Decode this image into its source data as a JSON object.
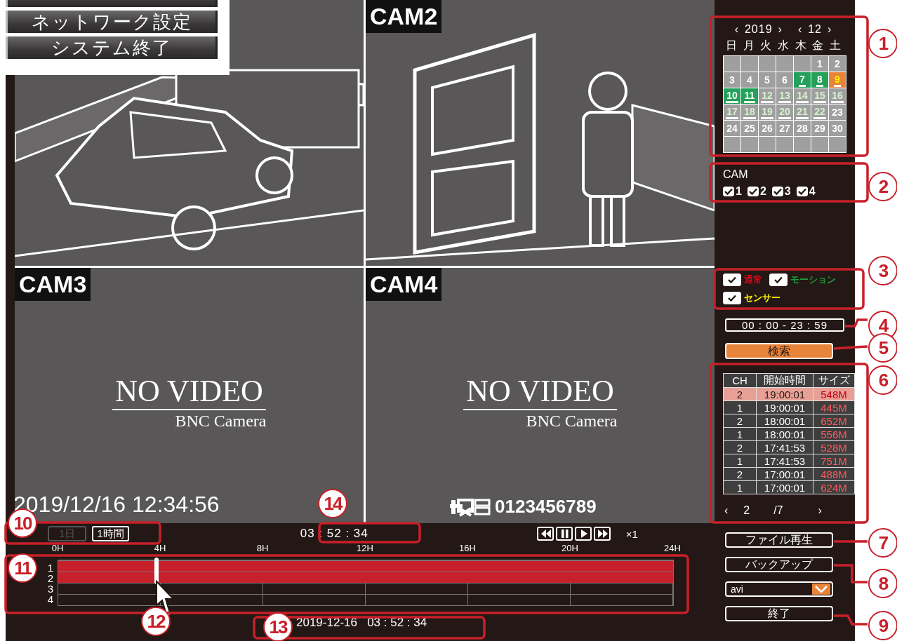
{
  "menu": {
    "items": [
      {
        "label": "ネットワーク設定"
      },
      {
        "label": "システム終了"
      }
    ]
  },
  "panes": [
    {
      "kind": "picture"
    },
    {
      "kind": "picture",
      "label": "CAM2"
    },
    {
      "kind": "no_video",
      "label": "CAM3",
      "message": "NO VIDEO",
      "source": "BNC Camera",
      "overlay": "2019/12/16  12:34:56"
    },
    {
      "kind": "no_video",
      "label": "CAM4",
      "message": "NO VIDEO",
      "source": "BNC Camera",
      "phone": "0123456789"
    }
  ],
  "calendar": {
    "prev_year": "‹",
    "year": "2019",
    "next_year": "›",
    "prev_month": "‹",
    "month": "12",
    "next_month": "›",
    "weekdays": [
      "日",
      "月",
      "火",
      "水",
      "木",
      "金",
      "土"
    ],
    "days": [
      {
        "kind": "empty"
      },
      {
        "kind": "empty"
      },
      {
        "kind": "empty"
      },
      {
        "kind": "empty"
      },
      {
        "kind": "empty"
      },
      {
        "label": "1",
        "kind": "plain"
      },
      {
        "label": "2",
        "kind": "plain"
      },
      {
        "label": "3",
        "kind": "plain"
      },
      {
        "label": "4",
        "kind": "plain"
      },
      {
        "label": "5",
        "kind": "plain"
      },
      {
        "label": "6",
        "kind": "plain"
      },
      {
        "label": "7",
        "kind": "marked"
      },
      {
        "label": "8",
        "kind": "marked"
      },
      {
        "label": "9",
        "kind": "selected"
      },
      {
        "label": "10",
        "kind": "marked"
      },
      {
        "label": "11",
        "kind": "marked"
      },
      {
        "label": "12",
        "kind": "recorded"
      },
      {
        "label": "13",
        "kind": "recorded"
      },
      {
        "label": "14",
        "kind": "recorded"
      },
      {
        "label": "15",
        "kind": "recorded"
      },
      {
        "label": "16",
        "kind": "recorded"
      },
      {
        "label": "17",
        "kind": "recorded"
      },
      {
        "label": "18",
        "kind": "recorded"
      },
      {
        "label": "19",
        "kind": "recorded"
      },
      {
        "label": "20",
        "kind": "recorded"
      },
      {
        "label": "21",
        "kind": "recorded"
      },
      {
        "label": "22",
        "kind": "recorded"
      },
      {
        "label": "23",
        "kind": "plain"
      },
      {
        "label": "24",
        "kind": "plain"
      },
      {
        "label": "25",
        "kind": "plain"
      },
      {
        "label": "26",
        "kind": "plain"
      },
      {
        "label": "27",
        "kind": "plain"
      },
      {
        "label": "28",
        "kind": "plain"
      },
      {
        "label": "29",
        "kind": "plain"
      },
      {
        "label": "30",
        "kind": "plain"
      },
      {
        "kind": "empty"
      },
      {
        "kind": "empty"
      },
      {
        "kind": "empty"
      },
      {
        "kind": "empty"
      },
      {
        "kind": "empty"
      },
      {
        "kind": "empty"
      },
      {
        "kind": "empty"
      }
    ]
  },
  "cam_filter": {
    "title": "CAM",
    "cams": [
      {
        "label": "1",
        "checked": true
      },
      {
        "label": "2",
        "checked": true
      },
      {
        "label": "3",
        "checked": true
      },
      {
        "label": "4",
        "checked": true
      }
    ]
  },
  "record_types": [
    {
      "label": "通常",
      "checked": true,
      "color": "#e60012"
    },
    {
      "label": "モーション",
      "checked": true,
      "color": "#1e9a3a"
    },
    {
      "label": "センサー",
      "checked": true,
      "color": "#fff100"
    }
  ],
  "time_range": "00 : 00 - 23 : 59",
  "search_button": "検索",
  "file_table": {
    "columns": [
      "CH",
      "開始時間",
      "サイズ"
    ],
    "rows": [
      {
        "ch": "2",
        "start": "19:00:01",
        "size": "548M",
        "selected": true
      },
      {
        "ch": "1",
        "start": "19:00:01",
        "size": "445M",
        "selected": false
      },
      {
        "ch": "2",
        "start": "18:00:01",
        "size": "652M",
        "selected": false
      },
      {
        "ch": "1",
        "start": "18:00:01",
        "size": "556M",
        "selected": false
      },
      {
        "ch": "2",
        "start": "17:41:53",
        "size": "528M",
        "selected": false
      },
      {
        "ch": "1",
        "start": "17:41:53",
        "size": "751M",
        "selected": false
      },
      {
        "ch": "2",
        "start": "17:00:01",
        "size": "488M",
        "selected": false
      },
      {
        "ch": "1",
        "start": "17:00:01",
        "size": "624M",
        "selected": false
      }
    ],
    "pager": {
      "prev": "‹",
      "page": "2",
      "total": "/7",
      "next": "›"
    }
  },
  "actions": {
    "play_file": "ファイル再生",
    "backup": "バックアップ",
    "format": "avi",
    "exit": "終了"
  },
  "timeline": {
    "zoom": [
      {
        "label": "1日",
        "selected": false,
        "disabled": true
      },
      {
        "label": "1時間",
        "selected": true,
        "disabled": false
      }
    ],
    "current_time": "03 : 52 : 34",
    "speed": "×1",
    "hours": [
      "0H",
      "4H",
      "8H",
      "12H",
      "16H",
      "20H",
      "24H"
    ],
    "channels": [
      {
        "label": "1",
        "recorded": true
      },
      {
        "label": "2",
        "recorded": true
      },
      {
        "label": "3",
        "recorded": false
      },
      {
        "label": "4",
        "recorded": false
      }
    ],
    "playhead": {
      "level": 0.16
    },
    "position": "2019-12-16   03 : 52 : 34"
  },
  "callouts": [
    {
      "number": "1"
    },
    {
      "number": "2"
    },
    {
      "number": "3"
    },
    {
      "number": "4"
    },
    {
      "number": "5"
    },
    {
      "number": "6"
    },
    {
      "number": "7"
    },
    {
      "number": "8"
    },
    {
      "number": "9"
    },
    {
      "number": "10"
    },
    {
      "number": "11"
    },
    {
      "number": "12"
    },
    {
      "number": "13"
    },
    {
      "number": "14"
    }
  ]
}
